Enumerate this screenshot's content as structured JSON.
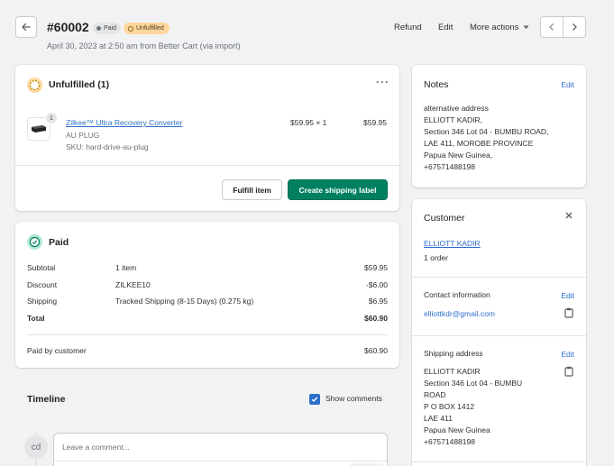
{
  "header": {
    "order_number": "#60002",
    "badge_paid": "Paid",
    "badge_unfulfilled": "Unfulfilled",
    "subtitle": "April 30, 2023 at 2:50 am from Better Cart (via import)",
    "refund": "Refund",
    "edit": "Edit",
    "more_actions": "More actions"
  },
  "fulfillment": {
    "title": "Unfulfilled (1)",
    "item": {
      "quantity_badge": "1",
      "name": "Zilkee™ Ultra Recovery Converter",
      "variant": "AU PLUG",
      "sku": "SKU: hard-drive-au-plug",
      "price_qty": "$59.95 × 1",
      "total": "$59.95"
    },
    "fulfill_button": "Fulfill item",
    "shipping_label_button": "Create shipping label"
  },
  "payment": {
    "title": "Paid",
    "rows": [
      {
        "label": "Subtotal",
        "detail": "1 item",
        "amount": "$59.95"
      },
      {
        "label": "Discount",
        "detail": "ZILKEE10",
        "amount": "-$6.00"
      },
      {
        "label": "Shipping",
        "detail": "Tracked Shipping (8-15 Days) (0.275 kg)",
        "amount": "$6.95"
      },
      {
        "label": "Total",
        "detail": "",
        "amount": "$60.90"
      }
    ],
    "paid_by_customer_label": "Paid by customer",
    "paid_by_customer_amount": "$60.90"
  },
  "timeline": {
    "title": "Timeline",
    "show_comments": "Show comments",
    "avatar_initials": "cd",
    "comment_placeholder": "Leave a comment..."
  },
  "notes": {
    "title": "Notes",
    "edit": "Edit",
    "lines": [
      "alternative address",
      "ELLIOTT KADIR,",
      "Section 346 Lot 04 - BUMBU ROAD,",
      "LAE 411, MOROBE PROVINCE",
      "Papua New Guinea,",
      "+67571488198"
    ]
  },
  "customer": {
    "title": "Customer",
    "name": "ELLIOTT KADIR",
    "orders": "1 order",
    "contact_title": "Contact information",
    "contact_edit": "Edit",
    "email": "elliottkdr@gmail.com",
    "shipping_title": "Shipping address",
    "shipping_edit": "Edit",
    "shipping_lines": [
      "ELLIOTT KADIR",
      "Section 346 Lot 04 - BUMBU",
      "ROAD",
      "P O BOX 1412",
      "LAE 411",
      "Papua New Guinea",
      "+67571488198"
    ]
  },
  "colors": {
    "primary": "#008060",
    "link": "#2c6ecb",
    "unfulfilled_badge": "#ffd79d",
    "paid_badge": "#e4e5e7"
  }
}
